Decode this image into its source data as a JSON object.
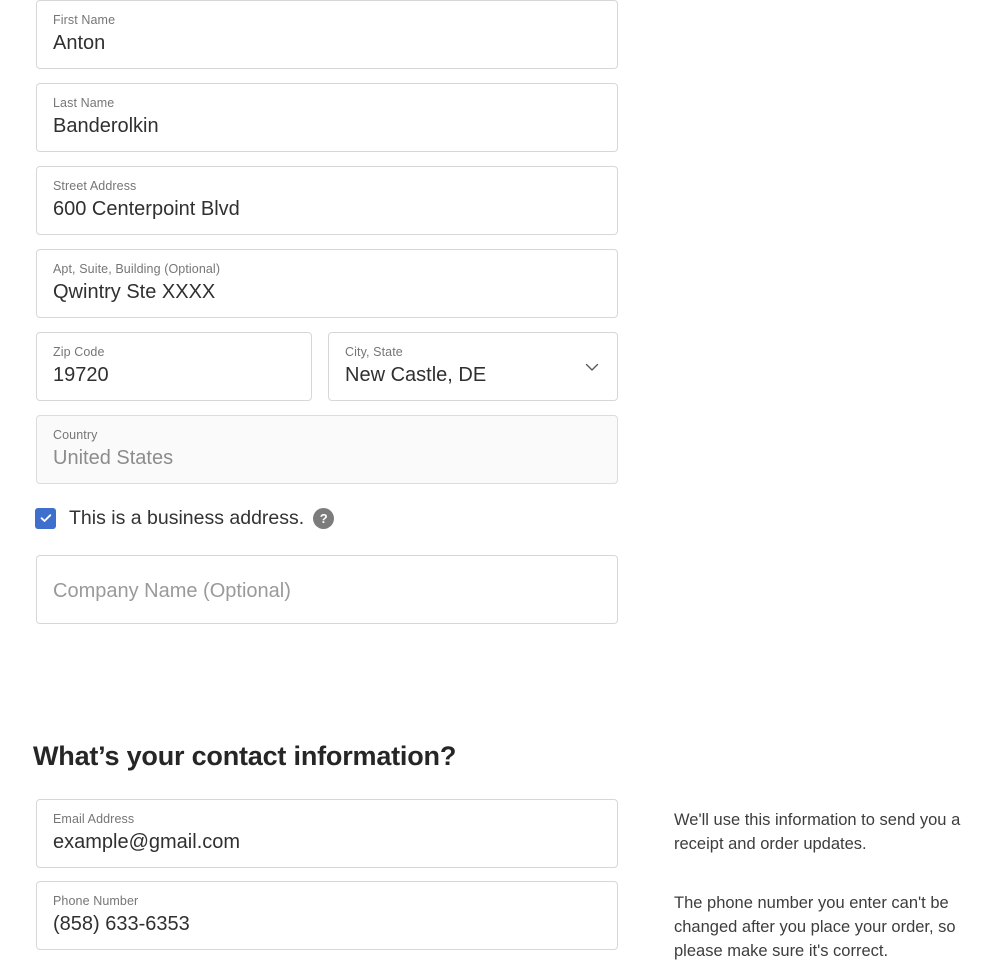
{
  "theme": {
    "accent": "#3e6fcc",
    "border": "#d7d7d7",
    "disabled_bg": "#fafafa",
    "label_color": "#767676",
    "value_color": "#303030",
    "help_icon_bg": "#7c7c7c"
  },
  "address_form": {
    "fields": [
      {
        "name": "first-name",
        "label": "First Name",
        "value": "Anton"
      },
      {
        "name": "last-name",
        "label": "Last Name",
        "value": "Banderolkin"
      },
      {
        "name": "street-address",
        "label": "Street Address",
        "value": "600 Centerpoint Blvd"
      },
      {
        "name": "apt-suite",
        "label": "Apt, Suite, Building (Optional)",
        "value": "Qwintry Ste XXXX"
      },
      {
        "name": "zip-code",
        "label": "Zip Code",
        "value": "19720"
      },
      {
        "name": "city-state",
        "label": "City, State",
        "value": "New Castle, DE"
      },
      {
        "name": "country",
        "label": "Country",
        "value": "United States"
      }
    ],
    "business_checkbox": {
      "checked": true,
      "label": "This is a business address.",
      "help_icon": "question-mark-icon",
      "help_glyph": "?"
    },
    "company_name": {
      "placeholder": "Company Name (Optional)",
      "value": ""
    },
    "city_state_icon": "chevron-down-icon"
  },
  "contact_section": {
    "heading": "What’s your contact information?",
    "fields": [
      {
        "name": "email-address",
        "label": "Email Address",
        "value": "example@gmail.com"
      },
      {
        "name": "phone-number",
        "label": "Phone Number",
        "value": "(858) 633-6353"
      }
    ]
  },
  "helper_text": {
    "paragraph_1_line_1": "We'll use this information to send you a",
    "paragraph_1_line_2": "receipt and order updates.",
    "paragraph_2_line_1": "The phone number you enter can't be",
    "paragraph_2_line_2": "changed after you place your order, so",
    "paragraph_2_line_3": "please make sure it's correct."
  }
}
